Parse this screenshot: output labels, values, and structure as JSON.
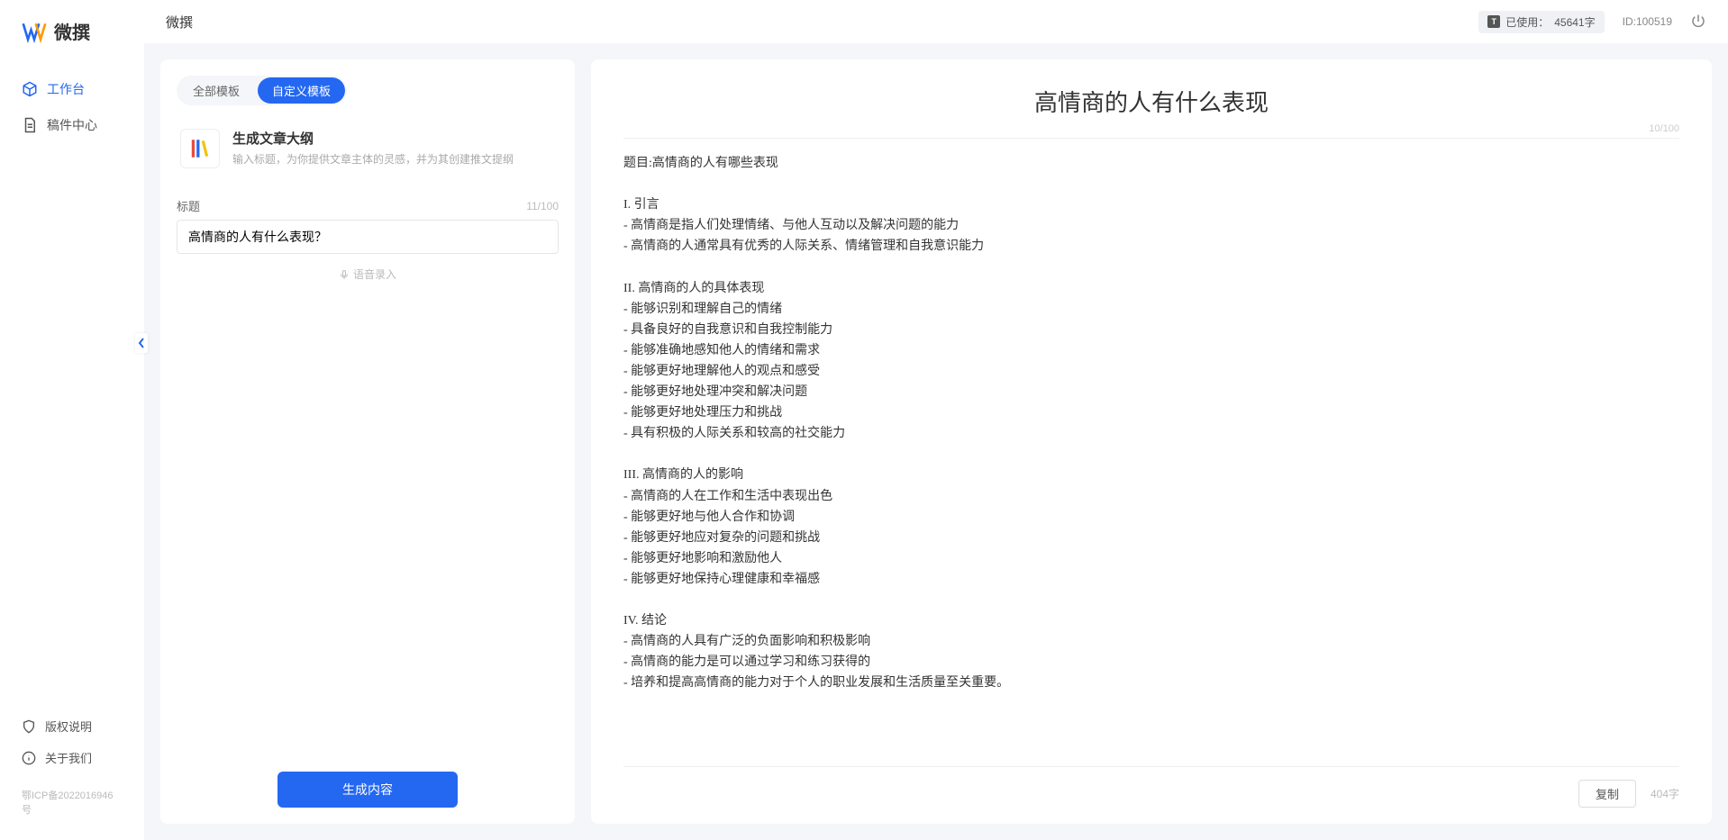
{
  "brand": "微撰",
  "topbar": {
    "title": "微撰",
    "usage_prefix": "已使用：",
    "usage_value": "45641字",
    "user_id": "ID:100519"
  },
  "sidebar": {
    "nav": [
      {
        "label": "工作台",
        "active": true,
        "icon": "cube"
      },
      {
        "label": "稿件中心",
        "active": false,
        "icon": "doc"
      }
    ],
    "footer": [
      {
        "label": "版权说明",
        "icon": "shield"
      },
      {
        "label": "关于我们",
        "icon": "info"
      }
    ],
    "icp": "鄂ICP备2022016946号"
  },
  "left_panel": {
    "tabs": [
      {
        "label": "全部模板",
        "active": false
      },
      {
        "label": "自定义模板",
        "active": true
      }
    ],
    "template": {
      "title": "生成文章大纲",
      "desc": "输入标题，为你提供文章主体的灵感，并为其创建推文提纲"
    },
    "field": {
      "label": "标题",
      "count": "11/100",
      "value": "高情商的人有什么表现？"
    },
    "voice_label": "语音录入",
    "generate_btn": "生成内容"
  },
  "right_panel": {
    "title": "高情商的人有什么表现",
    "title_count": "10/100",
    "body": "题目:高情商的人有哪些表现\n\nI. 引言\n- 高情商是指人们处理情绪、与他人互动以及解决问题的能力\n- 高情商的人通常具有优秀的人际关系、情绪管理和自我意识能力\n\nII. 高情商的人的具体表现\n- 能够识别和理解自己的情绪\n- 具备良好的自我意识和自我控制能力\n- 能够准确地感知他人的情绪和需求\n- 能够更好地理解他人的观点和感受\n- 能够更好地处理冲突和解决问题\n- 能够更好地处理压力和挑战\n- 具有积极的人际关系和较高的社交能力\n\nIII. 高情商的人的影响\n- 高情商的人在工作和生活中表现出色\n- 能够更好地与他人合作和协调\n- 能够更好地应对复杂的问题和挑战\n- 能够更好地影响和激励他人\n- 能够更好地保持心理健康和幸福感\n\nIV. 结论\n- 高情商的人具有广泛的负面影响和积极影响\n- 高情商的能力是可以通过学习和练习获得的\n- 培养和提高高情商的能力对于个人的职业发展和生活质量至关重要。",
    "copy_btn": "复制",
    "char_count": "404字"
  }
}
